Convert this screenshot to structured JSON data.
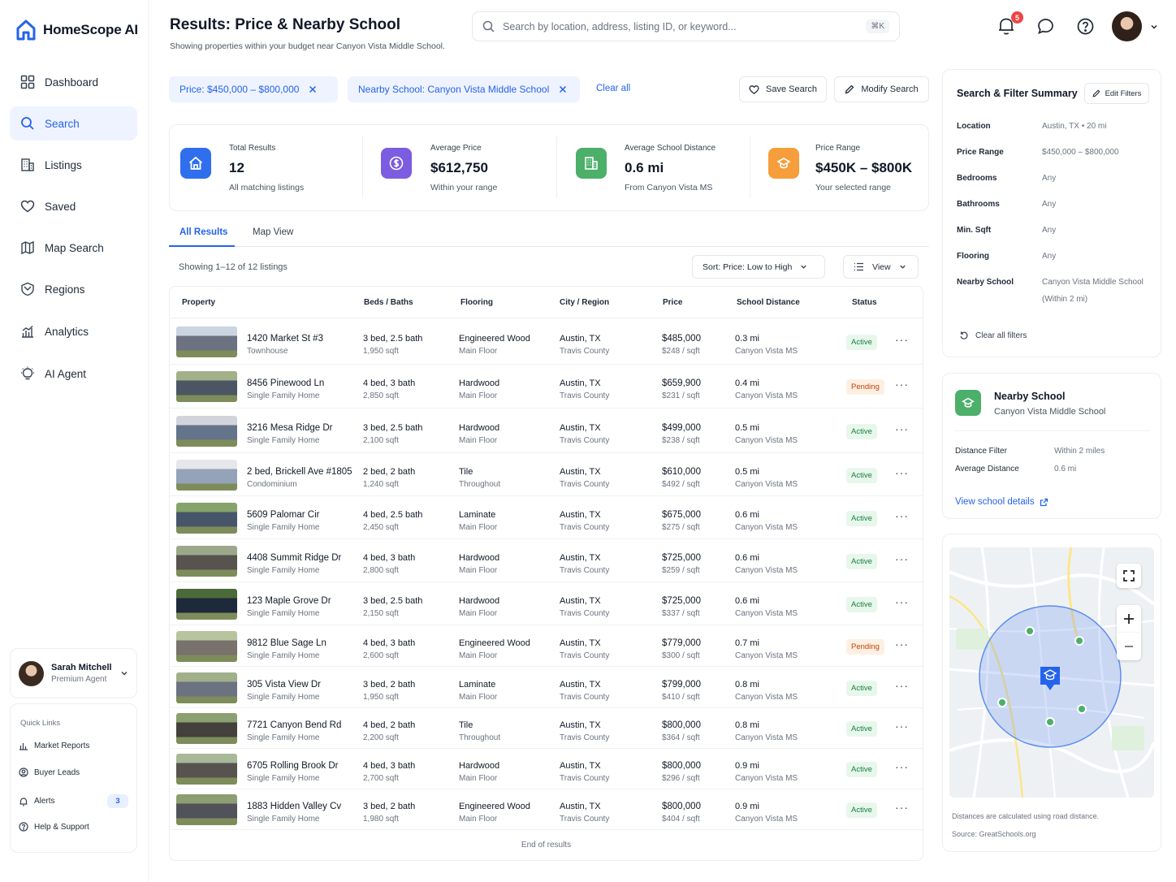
{
  "app": {
    "name": "HomeScope AI"
  },
  "sidebar": {
    "items": [
      {
        "label": "Dashboard"
      },
      {
        "label": "Search"
      },
      {
        "label": "Listings"
      },
      {
        "label": "Saved"
      },
      {
        "label": "Map Search"
      },
      {
        "label": "Regions"
      },
      {
        "label": "Analytics"
      },
      {
        "label": "AI Agent"
      }
    ],
    "user": {
      "name": "Sarah Mitchell",
      "role": "Premium Agent"
    },
    "quick_links": {
      "heading": "Quick Links",
      "items": [
        {
          "label": "Market Reports"
        },
        {
          "label": "Buyer Leads"
        },
        {
          "label": "Alerts",
          "count": "3"
        },
        {
          "label": "Help & Support"
        }
      ]
    }
  },
  "header": {
    "title": "Results: Price & Nearby School",
    "subtitle": "Showing properties within your budget near Canyon Vista Middle School.",
    "search_placeholder": "Search by location, address, listing ID, or keyword...",
    "search_shortcut": "⌘K",
    "notification_count": "5"
  },
  "filters": {
    "chips": [
      {
        "label": "Price: $450,000 – $800,000"
      },
      {
        "label": "Nearby School: Canyon Vista Middle School"
      }
    ],
    "clear_all": "Clear all",
    "save_search": "Save Search",
    "modify_search": "Modify Search"
  },
  "stats": [
    {
      "label": "Total Results",
      "value": "12",
      "sub": "All matching listings",
      "color": "#2f6fed",
      "icon": "home-icon"
    },
    {
      "label": "Average Price",
      "value": "$612,750",
      "sub": "Within your range",
      "color": "#7c5ce0",
      "icon": "dollar-icon"
    },
    {
      "label": "Average School Distance",
      "value": "0.6 mi",
      "sub": "From Canyon Vista MS",
      "color": "#4caf6a",
      "icon": "building-icon"
    },
    {
      "label": "Price Range",
      "value": "$450K – $800K",
      "sub": "Your selected range",
      "color": "#f59e3b",
      "icon": "school-icon"
    }
  ],
  "tabs": [
    {
      "label": "All Results"
    },
    {
      "label": "Map View"
    }
  ],
  "results": {
    "showing": "Showing 1–12 of 12 listings",
    "sort_label": "Sort: Price: Low to High",
    "view_label": "View",
    "columns": [
      "Property",
      "Beds / Baths",
      "Flooring",
      "City / Region",
      "Price",
      "School Distance",
      "Status"
    ],
    "rows": [
      {
        "address": "1420 Market St #3",
        "type": "Townhouse",
        "beds": "3 bed, 2.5 bath",
        "sqft": "1,950 sqft",
        "floor": "Engineered Wood",
        "floor_loc": "Main Floor",
        "city": "Austin, TX",
        "county": "Travis County",
        "price": "$485,000",
        "ppsf": "$248 / sqft",
        "dist": "0.3 mi",
        "school": "Canyon Vista MS",
        "status": "Active"
      },
      {
        "address": "8456 Pinewood Ln",
        "type": "Single Family Home",
        "beds": "4 bed, 3 bath",
        "sqft": "2,850 sqft",
        "floor": "Hardwood",
        "floor_loc": "Main Floor",
        "city": "Austin, TX",
        "county": "Travis County",
        "price": "$659,900",
        "ppsf": "$231 / sqft",
        "dist": "0.4 mi",
        "school": "Canyon Vista MS",
        "status": "Pending"
      },
      {
        "address": "3216 Mesa Ridge Dr",
        "type": "Single Family Home",
        "beds": "3 bed, 2.5 bath",
        "sqft": "2,100 sqft",
        "floor": "Hardwood",
        "floor_loc": "Main Floor",
        "city": "Austin, TX",
        "county": "Travis County",
        "price": "$499,000",
        "ppsf": "$238 / sqft",
        "dist": "0.5 mi",
        "school": "Canyon Vista MS",
        "status": "Active"
      },
      {
        "address": "2 bed, Brickell Ave #1805",
        "type": "Condominium",
        "beds": "2 bed, 2 bath",
        "sqft": "1,240 sqft",
        "floor": "Tile",
        "floor_loc": "Throughout",
        "city": "Austin, TX",
        "county": "Travis County",
        "price": "$610,000",
        "ppsf": "$492 / sqft",
        "dist": "0.5 mi",
        "school": "Canyon Vista MS",
        "status": "Active"
      },
      {
        "address": "5609 Palomar Cir",
        "type": "Single Family Home",
        "beds": "4 bed, 2.5 bath",
        "sqft": "2,450 sqft",
        "floor": "Laminate",
        "floor_loc": "Main Floor",
        "city": "Austin, TX",
        "county": "Travis County",
        "price": "$675,000",
        "ppsf": "$275 / sqft",
        "dist": "0.6 mi",
        "school": "Canyon Vista MS",
        "status": "Active"
      },
      {
        "address": "4408 Summit Ridge Dr",
        "type": "Single Family Home",
        "beds": "4 bed, 3 bath",
        "sqft": "2,800 sqft",
        "floor": "Hardwood",
        "floor_loc": "Main Floor",
        "city": "Austin, TX",
        "county": "Travis County",
        "price": "$725,000",
        "ppsf": "$259 / sqft",
        "dist": "0.6 mi",
        "school": "Canyon Vista MS",
        "status": "Active"
      },
      {
        "address": "123 Maple Grove Dr",
        "type": "Single Family Home",
        "beds": "3 bed, 2.5 bath",
        "sqft": "2,150 sqft",
        "floor": "Hardwood",
        "floor_loc": "Main Floor",
        "city": "Austin, TX",
        "county": "Travis County",
        "price": "$725,000",
        "ppsf": "$337 / sqft",
        "dist": "0.6 mi",
        "school": "Canyon Vista MS",
        "status": "Active"
      },
      {
        "address": "9812 Blue Sage Ln",
        "type": "Single Family Home",
        "beds": "4 bed, 3 bath",
        "sqft": "2,600 sqft",
        "floor": "Engineered Wood",
        "floor_loc": "Main Floor",
        "city": "Austin, TX",
        "county": "Travis County",
        "price": "$779,000",
        "ppsf": "$300 / sqft",
        "dist": "0.7 mi",
        "school": "Canyon Vista MS",
        "status": "Pending"
      },
      {
        "address": "305 Vista View Dr",
        "type": "Single Family Home",
        "beds": "3 bed, 2 bath",
        "sqft": "1,950 sqft",
        "floor": "Laminate",
        "floor_loc": "Main Floor",
        "city": "Austin, TX",
        "county": "Travis County",
        "price": "$799,000",
        "ppsf": "$410 / sqft",
        "dist": "0.8 mi",
        "school": "Canyon Vista MS",
        "status": "Active"
      },
      {
        "address": "7721 Canyon Bend Rd",
        "type": "Single Family Home",
        "beds": "4 bed, 2 bath",
        "sqft": "2,200 sqft",
        "floor": "Tile",
        "floor_loc": "Throughout",
        "city": "Austin, TX",
        "county": "Travis County",
        "price": "$800,000",
        "ppsf": "$364 / sqft",
        "dist": "0.8 mi",
        "school": "Canyon Vista MS",
        "status": "Active"
      },
      {
        "address": "6705 Rolling Brook Dr",
        "type": "Single Family Home",
        "beds": "4 bed, 3 bath",
        "sqft": "2,700 sqft",
        "floor": "Hardwood",
        "floor_loc": "Main Floor",
        "city": "Austin, TX",
        "county": "Travis County",
        "price": "$800,000",
        "ppsf": "$296 / sqft",
        "dist": "0.9 mi",
        "school": "Canyon Vista MS",
        "status": "Active"
      },
      {
        "address": "1883 Hidden Valley Cv",
        "type": "Single Family Home",
        "beds": "3 bed, 2 bath",
        "sqft": "1,980 sqft",
        "floor": "Engineered Wood",
        "floor_loc": "Main Floor",
        "city": "Austin, TX",
        "county": "Travis County",
        "price": "$800,000",
        "ppsf": "$404 / sqft",
        "dist": "0.9 mi",
        "school": "Canyon Vista MS",
        "status": "Active"
      }
    ],
    "end_text": "End of results"
  },
  "summary": {
    "title": "Search & Filter Summary",
    "edit_label": "Edit Filters",
    "items": [
      {
        "key": "Location",
        "value": "Austin, TX • 20 mi"
      },
      {
        "key": "Price Range",
        "value": "$450,000 – $800,000"
      },
      {
        "key": "Bedrooms",
        "value": "Any"
      },
      {
        "key": "Bathrooms",
        "value": "Any"
      },
      {
        "key": "Min. Sqft",
        "value": "Any"
      },
      {
        "key": "Flooring",
        "value": "Any"
      },
      {
        "key": "Nearby School",
        "value": "Canyon Vista Middle School (Within 2 mi)"
      }
    ],
    "clear_label": "Clear all filters"
  },
  "school": {
    "title": "Nearby School",
    "name": "Canyon Vista Middle School",
    "distance_filter_label": "Distance Filter",
    "distance_filter_value": "Within 2 miles",
    "avg_distance_label": "Average Distance",
    "avg_distance_value": "0.6 mi",
    "link": "View school details"
  },
  "map": {
    "note1": "Distances are calculated using road distance.",
    "note2": "Source: GreatSchools.org"
  },
  "colors": {
    "accent": "#2563eb",
    "active": "#15803d",
    "pending": "#c2410c"
  }
}
